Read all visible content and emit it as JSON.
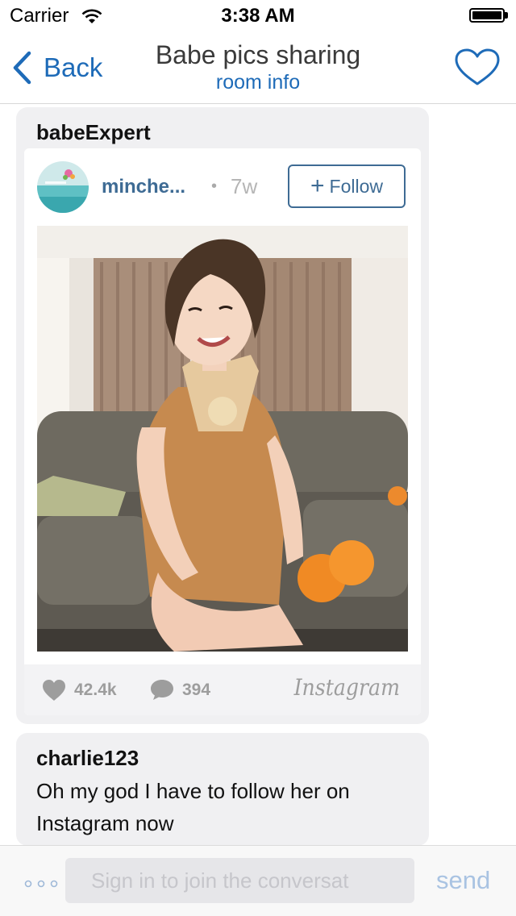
{
  "status_bar": {
    "carrier": "Carrier",
    "time": "3:38 AM"
  },
  "nav": {
    "back_label": "Back",
    "title": "Babe pics sharing",
    "subtitle": "room info",
    "accent_color": "#1e6bb8"
  },
  "messages": [
    {
      "sender": "babeExpert",
      "instagram": {
        "username": "minche...",
        "separator": "•",
        "time_ago": "7w",
        "follow_label": "Follow",
        "likes": "42.4k",
        "comments": "394",
        "brand": "Instagram"
      }
    },
    {
      "sender": "charlie123",
      "text": "Oh my god I have to follow her on Instagram now"
    }
  ],
  "composer": {
    "placeholder": "Sign in to join the conversat",
    "send_label": "send"
  },
  "icons": [
    "wifi-icon",
    "battery-icon",
    "chevron-left-icon",
    "heart-outline-icon",
    "plus-icon",
    "heart-icon",
    "comment-icon",
    "more-dots-icon"
  ]
}
